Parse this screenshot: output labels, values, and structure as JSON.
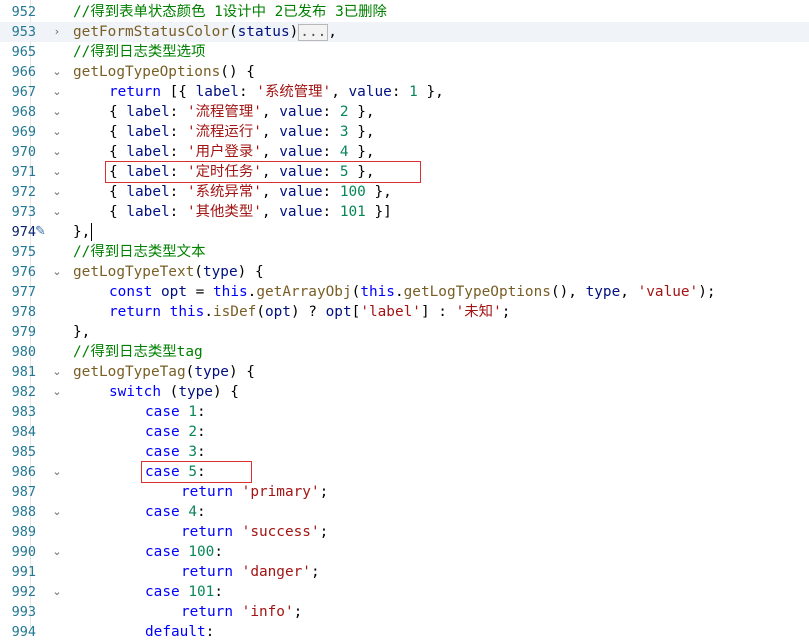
{
  "editor": {
    "lines": [
      {
        "n": "952",
        "fold": "",
        "indent": 1,
        "highlighted": false,
        "tokens": [
          [
            "cm",
            "//得到表单状态颜色 1设计中 2已发布 3已删除"
          ]
        ]
      },
      {
        "n": "953",
        "fold": ">",
        "indent": 1,
        "highlighted": true,
        "tokens": [
          [
            "fn",
            "getFormStatusColor"
          ],
          [
            "pun",
            "("
          ],
          [
            "prop",
            "status"
          ],
          [
            "pun",
            ")"
          ],
          [
            "ellipsis",
            "..."
          ],
          [
            "pun",
            ","
          ]
        ]
      },
      {
        "n": "965",
        "fold": "",
        "indent": 1,
        "highlighted": false,
        "tokens": [
          [
            "cm",
            "//得到日志类型选项"
          ]
        ]
      },
      {
        "n": "966",
        "fold": "v",
        "indent": 1,
        "highlighted": false,
        "tokens": [
          [
            "fn",
            "getLogTypeOptions"
          ],
          [
            "pun",
            "() {"
          ]
        ]
      },
      {
        "n": "967",
        "fold": "v",
        "indent": 2,
        "highlighted": false,
        "tokens": [
          [
            "kw",
            "return"
          ],
          [
            "pun",
            " [{ "
          ],
          [
            "prop",
            "label"
          ],
          [
            "pun",
            ": "
          ],
          [
            "str",
            "'系统管理'"
          ],
          [
            "pun",
            ", "
          ],
          [
            "prop",
            "value"
          ],
          [
            "pun",
            ": "
          ],
          [
            "num",
            "1"
          ],
          [
            "pun",
            " },"
          ]
        ]
      },
      {
        "n": "968",
        "fold": "v",
        "indent": 2,
        "highlighted": false,
        "tokens": [
          [
            "pun",
            "{ "
          ],
          [
            "prop",
            "label"
          ],
          [
            "pun",
            ": "
          ],
          [
            "str",
            "'流程管理'"
          ],
          [
            "pun",
            ", "
          ],
          [
            "prop",
            "value"
          ],
          [
            "pun",
            ": "
          ],
          [
            "num",
            "2"
          ],
          [
            "pun",
            " },"
          ]
        ]
      },
      {
        "n": "969",
        "fold": "v",
        "indent": 2,
        "highlighted": false,
        "tokens": [
          [
            "pun",
            "{ "
          ],
          [
            "prop",
            "label"
          ],
          [
            "pun",
            ": "
          ],
          [
            "str",
            "'流程运行'"
          ],
          [
            "pun",
            ", "
          ],
          [
            "prop",
            "value"
          ],
          [
            "pun",
            ": "
          ],
          [
            "num",
            "3"
          ],
          [
            "pun",
            " },"
          ]
        ]
      },
      {
        "n": "970",
        "fold": "v",
        "indent": 2,
        "highlighted": false,
        "tokens": [
          [
            "pun",
            "{ "
          ],
          [
            "prop",
            "label"
          ],
          [
            "pun",
            ": "
          ],
          [
            "str",
            "'用户登录'"
          ],
          [
            "pun",
            ", "
          ],
          [
            "prop",
            "value"
          ],
          [
            "pun",
            ": "
          ],
          [
            "num",
            "4"
          ],
          [
            "pun",
            " },"
          ]
        ]
      },
      {
        "n": "971",
        "fold": "v",
        "indent": 2,
        "highlighted": false,
        "tokens": [
          [
            "pun",
            "{ "
          ],
          [
            "prop",
            "label"
          ],
          [
            "pun",
            ": "
          ],
          [
            "str",
            "'定时任务'"
          ],
          [
            "pun",
            ", "
          ],
          [
            "prop",
            "value"
          ],
          [
            "pun",
            ": "
          ],
          [
            "num",
            "5"
          ],
          [
            "pun",
            " },"
          ]
        ]
      },
      {
        "n": "972",
        "fold": "v",
        "indent": 2,
        "highlighted": false,
        "tokens": [
          [
            "pun",
            "{ "
          ],
          [
            "prop",
            "label"
          ],
          [
            "pun",
            ": "
          ],
          [
            "str",
            "'系统异常'"
          ],
          [
            "pun",
            ", "
          ],
          [
            "prop",
            "value"
          ],
          [
            "pun",
            ": "
          ],
          [
            "num",
            "100"
          ],
          [
            "pun",
            " },"
          ]
        ]
      },
      {
        "n": "973",
        "fold": "v",
        "indent": 2,
        "highlighted": false,
        "tokens": [
          [
            "pun",
            "{ "
          ],
          [
            "prop",
            "label"
          ],
          [
            "pun",
            ": "
          ],
          [
            "str",
            "'其他类型'"
          ],
          [
            "pun",
            ", "
          ],
          [
            "prop",
            "value"
          ],
          [
            "pun",
            ": "
          ],
          [
            "num",
            "101"
          ],
          [
            "pun",
            " }]"
          ]
        ]
      },
      {
        "n": "974",
        "fold": "",
        "indent": 1,
        "highlighted": false,
        "active": true,
        "tokens": [
          [
            "pun",
            "},"
          ]
        ]
      },
      {
        "n": "975",
        "fold": "",
        "indent": 1,
        "highlighted": false,
        "tokens": [
          [
            "cm",
            "//得到日志类型文本"
          ]
        ]
      },
      {
        "n": "976",
        "fold": "v",
        "indent": 1,
        "highlighted": false,
        "tokens": [
          [
            "fn",
            "getLogTypeText"
          ],
          [
            "pun",
            "("
          ],
          [
            "prop",
            "type"
          ],
          [
            "pun",
            ") {"
          ]
        ]
      },
      {
        "n": "977",
        "fold": "",
        "indent": 2,
        "highlighted": false,
        "tokens": [
          [
            "kw",
            "const"
          ],
          [
            "pun",
            " "
          ],
          [
            "prop",
            "opt"
          ],
          [
            "pun",
            " = "
          ],
          [
            "kw",
            "this"
          ],
          [
            "pun",
            "."
          ],
          [
            "fn",
            "getArrayObj"
          ],
          [
            "pun",
            "("
          ],
          [
            "kw",
            "this"
          ],
          [
            "pun",
            "."
          ],
          [
            "fn",
            "getLogTypeOptions"
          ],
          [
            "pun",
            "(), "
          ],
          [
            "prop",
            "type"
          ],
          [
            "pun",
            ", "
          ],
          [
            "str",
            "'value'"
          ],
          [
            "pun",
            ");"
          ]
        ]
      },
      {
        "n": "978",
        "fold": "",
        "indent": 2,
        "highlighted": false,
        "tokens": [
          [
            "kw",
            "return"
          ],
          [
            "pun",
            " "
          ],
          [
            "kw",
            "this"
          ],
          [
            "pun",
            "."
          ],
          [
            "fn",
            "isDef"
          ],
          [
            "pun",
            "("
          ],
          [
            "prop",
            "opt"
          ],
          [
            "pun",
            ") ? "
          ],
          [
            "prop",
            "opt"
          ],
          [
            "pun",
            "["
          ],
          [
            "str",
            "'label'"
          ],
          [
            "pun",
            "] : "
          ],
          [
            "str",
            "'未知'"
          ],
          [
            "pun",
            ";"
          ]
        ]
      },
      {
        "n": "979",
        "fold": "",
        "indent": 1,
        "highlighted": false,
        "tokens": [
          [
            "pun",
            "},"
          ]
        ]
      },
      {
        "n": "980",
        "fold": "",
        "indent": 1,
        "highlighted": false,
        "tokens": [
          [
            "cm",
            "//得到日志类型tag"
          ]
        ]
      },
      {
        "n": "981",
        "fold": "v",
        "indent": 1,
        "highlighted": false,
        "tokens": [
          [
            "fn",
            "getLogTypeTag"
          ],
          [
            "pun",
            "("
          ],
          [
            "prop",
            "type"
          ],
          [
            "pun",
            ") {"
          ]
        ]
      },
      {
        "n": "982",
        "fold": "v",
        "indent": 2,
        "highlighted": false,
        "tokens": [
          [
            "kw",
            "switch"
          ],
          [
            "pun",
            " ("
          ],
          [
            "prop",
            "type"
          ],
          [
            "pun",
            ") {"
          ]
        ]
      },
      {
        "n": "983",
        "fold": "",
        "indent": 3,
        "highlighted": false,
        "tokens": [
          [
            "kw",
            "case"
          ],
          [
            "pun",
            " "
          ],
          [
            "num",
            "1"
          ],
          [
            "pun",
            ":"
          ]
        ]
      },
      {
        "n": "984",
        "fold": "",
        "indent": 3,
        "highlighted": false,
        "tokens": [
          [
            "kw",
            "case"
          ],
          [
            "pun",
            " "
          ],
          [
            "num",
            "2"
          ],
          [
            "pun",
            ":"
          ]
        ]
      },
      {
        "n": "985",
        "fold": "",
        "indent": 3,
        "highlighted": false,
        "tokens": [
          [
            "kw",
            "case"
          ],
          [
            "pun",
            " "
          ],
          [
            "num",
            "3"
          ],
          [
            "pun",
            ":"
          ]
        ]
      },
      {
        "n": "986",
        "fold": "v",
        "indent": 3,
        "highlighted": false,
        "tokens": [
          [
            "kw",
            "case"
          ],
          [
            "pun",
            " "
          ],
          [
            "num",
            "5"
          ],
          [
            "pun",
            ":"
          ]
        ]
      },
      {
        "n": "987",
        "fold": "",
        "indent": 4,
        "highlighted": false,
        "tokens": [
          [
            "kw",
            "return"
          ],
          [
            "pun",
            " "
          ],
          [
            "str",
            "'primary'"
          ],
          [
            "pun",
            ";"
          ]
        ]
      },
      {
        "n": "988",
        "fold": "v",
        "indent": 3,
        "highlighted": false,
        "tokens": [
          [
            "kw",
            "case"
          ],
          [
            "pun",
            " "
          ],
          [
            "num",
            "4"
          ],
          [
            "pun",
            ":"
          ]
        ]
      },
      {
        "n": "989",
        "fold": "",
        "indent": 4,
        "highlighted": false,
        "tokens": [
          [
            "kw",
            "return"
          ],
          [
            "pun",
            " "
          ],
          [
            "str",
            "'success'"
          ],
          [
            "pun",
            ";"
          ]
        ]
      },
      {
        "n": "990",
        "fold": "v",
        "indent": 3,
        "highlighted": false,
        "tokens": [
          [
            "kw",
            "case"
          ],
          [
            "pun",
            " "
          ],
          [
            "num",
            "100"
          ],
          [
            "pun",
            ":"
          ]
        ]
      },
      {
        "n": "991",
        "fold": "",
        "indent": 4,
        "highlighted": false,
        "tokens": [
          [
            "kw",
            "return"
          ],
          [
            "pun",
            " "
          ],
          [
            "str",
            "'danger'"
          ],
          [
            "pun",
            ";"
          ]
        ]
      },
      {
        "n": "992",
        "fold": "v",
        "indent": 3,
        "highlighted": false,
        "tokens": [
          [
            "kw",
            "case"
          ],
          [
            "pun",
            " "
          ],
          [
            "num",
            "101"
          ],
          [
            "pun",
            ":"
          ]
        ]
      },
      {
        "n": "993",
        "fold": "",
        "indent": 4,
        "highlighted": false,
        "tokens": [
          [
            "kw",
            "return"
          ],
          [
            "pun",
            " "
          ],
          [
            "str",
            "'info'"
          ],
          [
            "pun",
            ";"
          ]
        ]
      },
      {
        "n": "994",
        "fold": "",
        "indent": 3,
        "highlighted": false,
        "tokens": [
          [
            "kw",
            "default"
          ],
          [
            "pun",
            ":"
          ]
        ]
      }
    ],
    "colors": {
      "keyword": "#0000ff",
      "function": "#795e26",
      "property": "#001080",
      "string": "#a31515",
      "number": "#098658",
      "comment": "#008000",
      "line_number": "#237893",
      "annotation_box": "#d9302f"
    },
    "annotations": [
      "971",
      "986"
    ],
    "active_line_icon": "pin-icon"
  }
}
